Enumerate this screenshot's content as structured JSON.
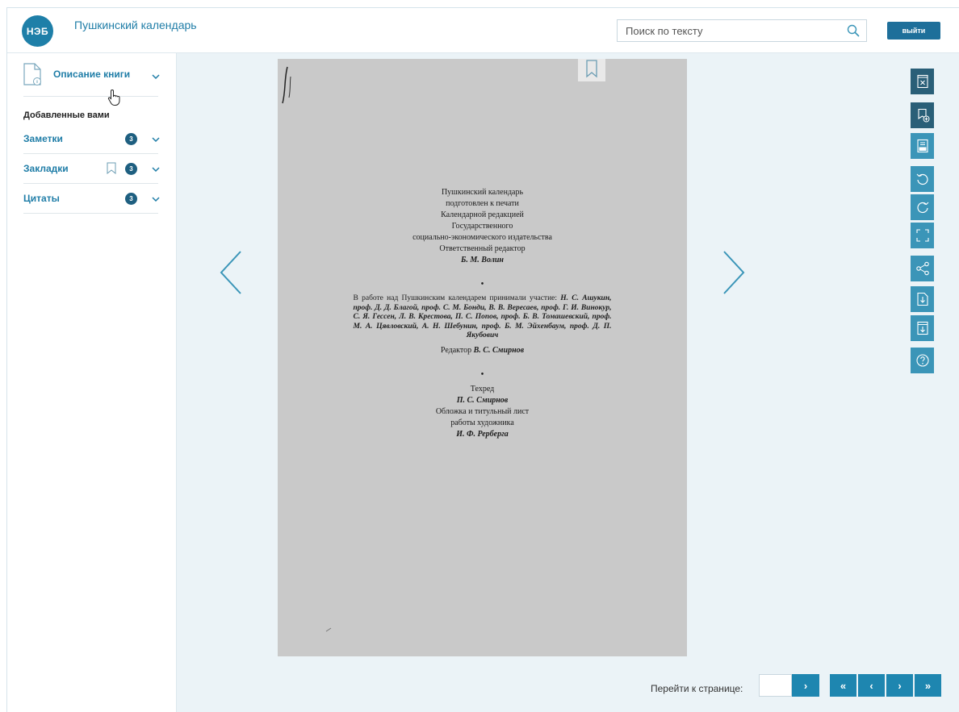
{
  "header": {
    "logo_text": "НЭБ",
    "book_title": "Пушкинский календарь",
    "search_placeholder": "Поиск по тексту",
    "logout_label": "выйти"
  },
  "sidebar": {
    "description_label": "Описание книги",
    "added_label": "Добавленные вами",
    "items": [
      {
        "label": "Заметки",
        "count": "3"
      },
      {
        "label": "Закладки",
        "count": "3"
      },
      {
        "label": "Цитаты",
        "count": "3"
      }
    ]
  },
  "page": {
    "lines_top": [
      "Пушкинский календарь",
      "подготовлен к печати",
      "Календарной редакцией",
      "Государственного",
      "социально-экономического издательства",
      "Ответственный редактор"
    ],
    "editor": "Б. М. Волин",
    "dot": "•",
    "credits_intro": "В работе над Пушкинским календарем принимали участие:",
    "credits_names": "Н. С. Ашукин, проф. Д. Д. Благой, проф. С. М. Бонди, В. В. Вересаев, проф. Г. И. Винокур, С. Я. Гессен, Л. В. Крестова, П. С. Попов, проф. Б. В. Томашевский, проф. М. А. Цявловский, А. Н. Шебунин, проф. Б. М. Эйхенбаум, проф. Д. П. Якубович",
    "redaktor_label": "Редактор",
    "redaktor_name": "В. С. Смирнов",
    "tehred_label": "Техред",
    "tehred_name": "П. С. Смирнов",
    "cover_line1": "Обложка и титульный лист",
    "cover_line2": "работы художника",
    "cover_artist": "И. Ф. Рерберга"
  },
  "footer": {
    "goto_label": "Перейти к странице:",
    "goto_value": "",
    "go_label": "›",
    "first_label": "«",
    "prev_label": "‹",
    "next_label": "›",
    "last_label": "»"
  },
  "toolbar_icons": [
    "close-book-icon",
    "add-bookmark-icon",
    "txt-icon",
    "rotate-left-icon",
    "rotate-right-icon",
    "fullscreen-icon",
    "share-icon",
    "download-icon",
    "download-page-icon",
    "help-icon"
  ],
  "colors": {
    "accent": "#1e86b0",
    "dark_accent": "#2a5f78",
    "link": "#1f7da7"
  }
}
